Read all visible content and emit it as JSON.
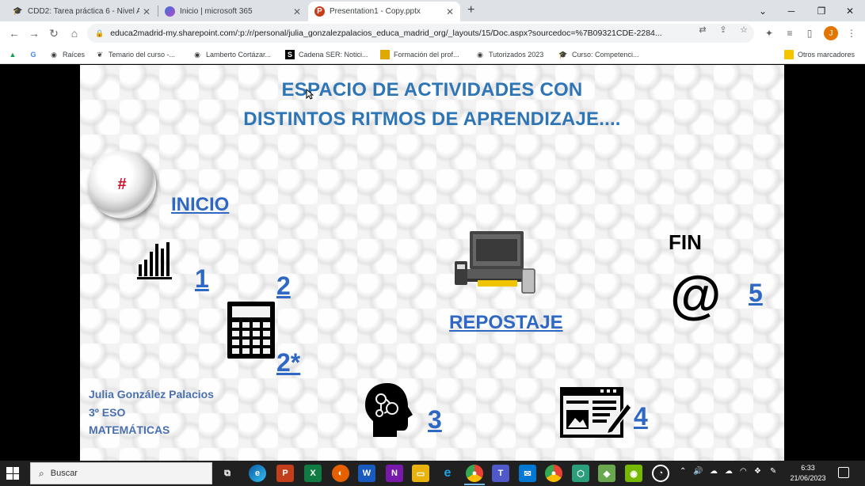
{
  "tabs": [
    {
      "label": "CDD2: Tarea práctica 6 - Nivel A2",
      "close": "✕"
    },
    {
      "label": "Inicio | microsoft 365",
      "close": "✕"
    },
    {
      "label": "Presentation1 - Copy.pptx",
      "close": "✕"
    }
  ],
  "new_tab": "+",
  "window_controls": {
    "minimize": "─",
    "maximize": "❐",
    "close": "✕",
    "menu": "⌄"
  },
  "address_bar": {
    "url": "educa2madrid-my.sharepoint.com/:p:/r/personal/julia_gonzalezpalacios_educa_madrid_org/_layouts/15/Doc.aspx?sourcedoc=%7B09321CDE-2284..."
  },
  "profile_initial": "J",
  "bookmarks": [
    {
      "label": "",
      "icon": "drive-icon"
    },
    {
      "label": "",
      "icon": "google-icon"
    },
    {
      "label": "Raíces"
    },
    {
      "label": "Temario del curso -..."
    },
    {
      "label": "Lamberto Cortázar..."
    },
    {
      "label": "Cadena SER: Notici..."
    },
    {
      "label": "Formación del prof..."
    },
    {
      "label": "Tutorizados 2023"
    },
    {
      "label": "Curso: Competenci..."
    }
  ],
  "other_bookmarks": "Otros marcadores",
  "slide": {
    "title_line1": "ESPACIO DE ACTIVIDADES CON",
    "title_line2": "DISTINTOS RITMOS DE APRENDIZAJE....",
    "home_symbol": "#",
    "inicio": "INICIO",
    "fin": "FIN",
    "repostaje": "REPOSTAJE",
    "at_symbol": "@",
    "num_1": "1",
    "num_2": "2",
    "num_2star": "2*",
    "num_3": "3",
    "num_4": "4",
    "num_5": "5",
    "author": "Julia González Palacios",
    "grade": "3º ESO",
    "subject": "MATEMÁTICAS"
  },
  "taskbar": {
    "search_placeholder": "Buscar",
    "time": "6:33",
    "date": "21/06/2023"
  }
}
